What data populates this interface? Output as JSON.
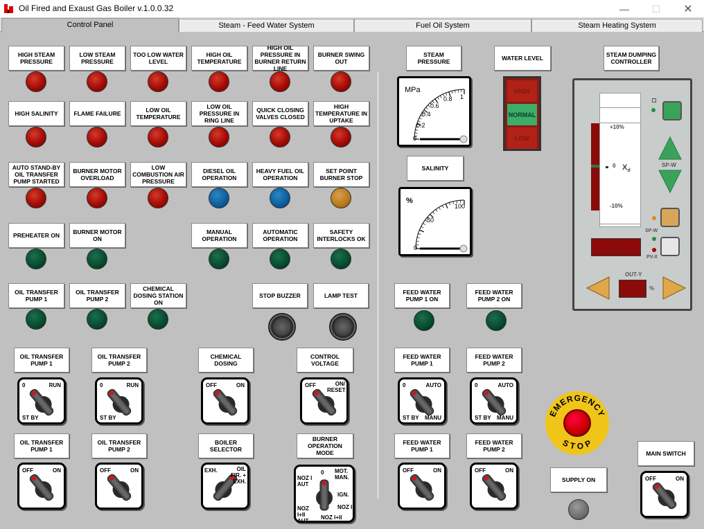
{
  "window": {
    "title": "Oil Fired and Exaust Gas Boiler  v.1.0.0.32",
    "minimize": "—",
    "maximize": "☐",
    "close": "✕"
  },
  "tabs": [
    "Control Panel",
    "Steam - Feed Water System",
    "Fuel Oil System",
    "Steam Heating System"
  ],
  "alarms": [
    {
      "label": "HIGH STEAM PRESSURE",
      "color": "red"
    },
    {
      "label": "LOW STEAM PRESSURE",
      "color": "red"
    },
    {
      "label": "TOO LOW WATER LEVEL",
      "color": "red"
    },
    {
      "label": "HIGH OIL TEMPERATURE",
      "color": "red"
    },
    {
      "label": "HIGH OIL PRESSURE IN BURNER RETURN LINE",
      "color": "red"
    },
    {
      "label": "BURNER SWING OUT",
      "color": "red"
    },
    {
      "label": "HIGH SALINITY",
      "color": "red"
    },
    {
      "label": "FLAME FAILURE",
      "color": "red"
    },
    {
      "label": "LOW OIL TEMPERATURE",
      "color": "red"
    },
    {
      "label": "LOW OIL PRESSURE IN RING LINE",
      "color": "red"
    },
    {
      "label": "QUICK CLOSING VALVES CLOSED",
      "color": "red"
    },
    {
      "label": "HIGH TEMPERATURE IN UPTAKE",
      "color": "red"
    },
    {
      "label": "AUTO STAND-BY OIL TRANSFER PUMP STARTED",
      "color": "red"
    },
    {
      "label": "BURNER MOTOR OVERLOAD",
      "color": "red"
    },
    {
      "label": "LOW COMBUSTION AIR PRESSURE",
      "color": "red"
    },
    {
      "label": "DIESEL OIL OPERATION",
      "color": "blue"
    },
    {
      "label": "HEAVY FUEL OIL OPERATION",
      "color": "blue"
    },
    {
      "label": "SET POINT BURNER STOP",
      "color": "amber"
    },
    {
      "label": "PREHEATER ON",
      "color": "green"
    },
    {
      "label": "BURNER MOTOR ON",
      "color": "green"
    },
    {
      "label": "MANUAL OPERATION",
      "color": "green"
    },
    {
      "label": "AUTOMATIC OPERATION",
      "color": "green"
    },
    {
      "label": "SAFETY INTERLOCKS OK",
      "color": "green"
    },
    {
      "label": "OIL TRANSFER PUMP 1",
      "color": "green"
    },
    {
      "label": "OIL TRANSFER PUMP 2",
      "color": "green"
    },
    {
      "label": "CHEMICAL DOSING STATION ON",
      "color": "green"
    }
  ],
  "buttons": {
    "stop_buzzer": "STOP BUZZER",
    "lamp_test": "LAMP TEST"
  },
  "feed_lamps": [
    "FEED WATER PUMP 1 ON",
    "FEED WATER PUMP 2 ON"
  ],
  "switches": [
    {
      "label": "OIL TRANSFER PUMP 1",
      "a": "0",
      "b": "RUN",
      "c": "ST BY"
    },
    {
      "label": "OIL TRANSFER PUMP 2",
      "a": "0",
      "b": "RUN",
      "c": "ST BY"
    },
    {
      "label": "CHEMICAL DOSING",
      "a": "OFF",
      "b": "ON"
    },
    {
      "label": "CONTROL VOLTAGE",
      "a": "OFF",
      "b": "ON/ RESET"
    },
    {
      "label": "FEED WATER PUMP 1",
      "a": "0",
      "b": "AUTO",
      "c": "ST BY",
      "d": "MANU"
    },
    {
      "label": "FEED WATER PUMP 2",
      "a": "0",
      "b": "AUTO",
      "c": "ST BY",
      "d": "MANU"
    },
    {
      "label": "OIL TRANSFER PUMP 1",
      "a": "OFF",
      "b": "ON"
    },
    {
      "label": "OIL TRANSFER PUMP 2",
      "a": "OFF",
      "b": "ON"
    },
    {
      "label": "BOILER SELECTOR",
      "a": "EXH.",
      "b": "OIL FIR. + EXH."
    },
    {
      "label": "BURNER OPERATION MODE",
      "a": "0",
      "b": "MOT. MAN.",
      "c": "IGN.",
      "d": "NOZ I",
      "e": "NOZ I AUT",
      "f": "NOZ I+II AUT",
      "g": "NOZ I+II"
    },
    {
      "label": "FEED WATER PUMP 1",
      "a": "OFF",
      "b": "ON"
    },
    {
      "label": "FEED WATER PUMP 2",
      "a": "OFF",
      "b": "ON"
    },
    {
      "label": "MAIN SWITCH",
      "a": "OFF",
      "b": "ON"
    }
  ],
  "steam_pressure": {
    "label": "STEAM PRESSURE",
    "unit": "MPa",
    "ticks": [
      "0",
      "0.2",
      "0.4",
      "0.6",
      "0.8",
      "1"
    ],
    "value": 0
  },
  "salinity": {
    "label": "SALINITY",
    "unit": "%",
    "ticks": [
      "0",
      "50",
      "100"
    ],
    "value": 0
  },
  "water_level": {
    "label": "WATER LEVEL",
    "high": "HIGH",
    "normal": "NORMAL",
    "low": "LOW",
    "active": "NORMAL"
  },
  "sdc": {
    "label": "STEAM DUMPING CONTROLLER",
    "plus": "+10%",
    "zero": "0",
    "minus": "-10%",
    "xd": "X",
    "xd_sub": "d",
    "spw": "SP-W",
    "spw2": "SP-W",
    "pvx": "PV-X",
    "outy": "OUT-Y",
    "pct": "%"
  },
  "supply_on": "SUPPLY ON",
  "estop": {
    "top": "EMERGENCY",
    "bottom": "STOP"
  }
}
